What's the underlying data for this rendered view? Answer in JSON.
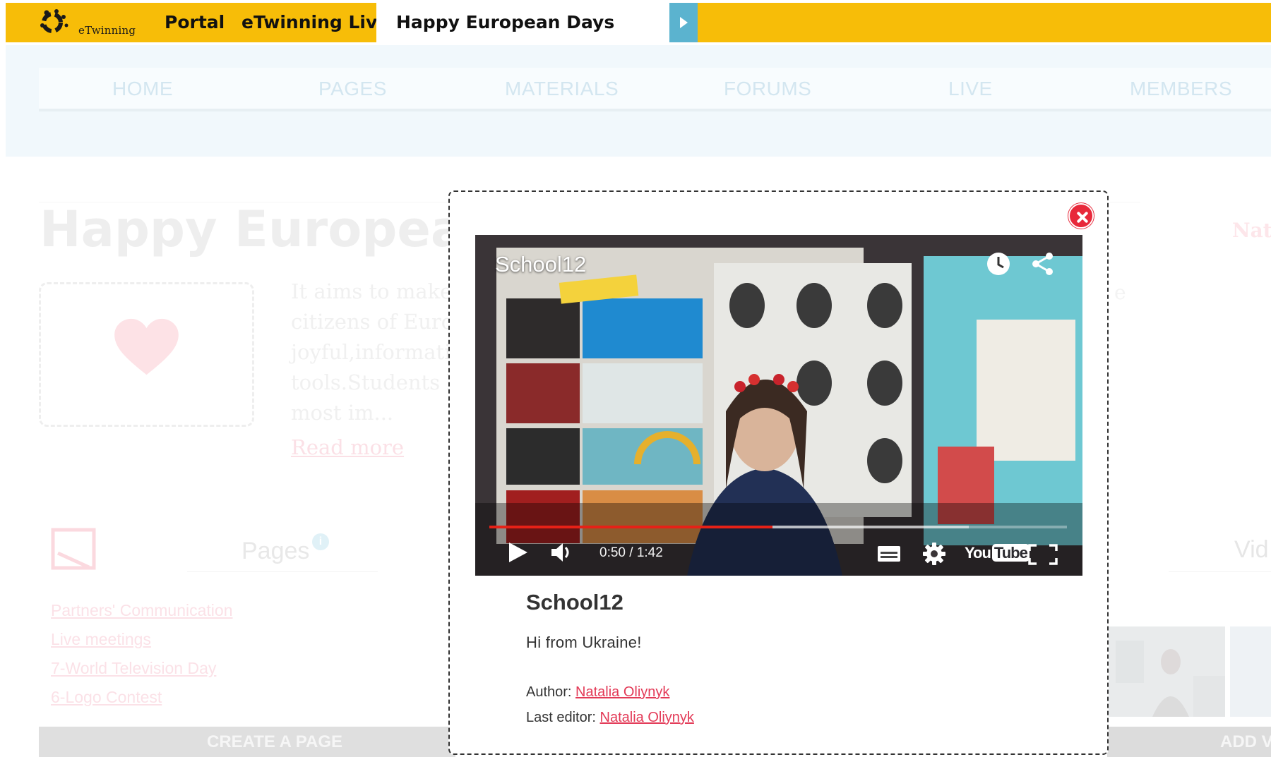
{
  "topbar": {
    "logo_text": "eTwinning",
    "portal_label": "Portal",
    "live_label": "eTwinning Live",
    "active_tab_label": "Happy European Days"
  },
  "nav": {
    "items": [
      "HOME",
      "PAGES",
      "MATERIALS",
      "FORUMS",
      "LIVE",
      "MEMBERS"
    ]
  },
  "background_page": {
    "title": "Happy European Days",
    "description_lines": [
      "It aims to make",
      "citizens of Euro",
      "joyful,informati",
      "tools.Students h",
      "most im..."
    ],
    "read_more": "Read more",
    "author_fragment": "Nat",
    "pages_panel": {
      "title": "Pages",
      "info_badge": "i",
      "links": [
        "Partners' Communication",
        "Live meetings",
        "7-World Television Day",
        "6-Logo Contest"
      ],
      "create_button": "CREATE A PAGE"
    },
    "videos_fragment": "Vid",
    "add_button_fragment": "ADD V"
  },
  "modal": {
    "player": {
      "title": "School12",
      "current_time": "0:50",
      "duration": "1:42",
      "time_display": "0:50 / 1:42",
      "progress": 0.49,
      "buffered": 0.83,
      "youtube_logo_you": "You",
      "youtube_logo_tube": "Tube"
    },
    "video_name": "School12",
    "video_description": "Hi from Ukraine!",
    "author_label": "Author:",
    "author_name": "Natalia Oliynyk",
    "editor_label": "Last editor:",
    "editor_name": "Natalia Oliynyk"
  },
  "colors": {
    "brand_yellow": "#f7bd08",
    "arrow_blue": "#5bb3cf",
    "close_red": "#e8283a",
    "link_pink": "#e33a57",
    "progress_red": "#e62117"
  },
  "icons": [
    "etwinning-logo-icon",
    "play-arrow-icon",
    "close-icon",
    "watch-later-icon",
    "share-icon",
    "play-icon",
    "volume-icon",
    "captions-icon",
    "settings-icon",
    "youtube-logo-icon",
    "fullscreen-icon",
    "heart-icon",
    "pages-icon"
  ]
}
